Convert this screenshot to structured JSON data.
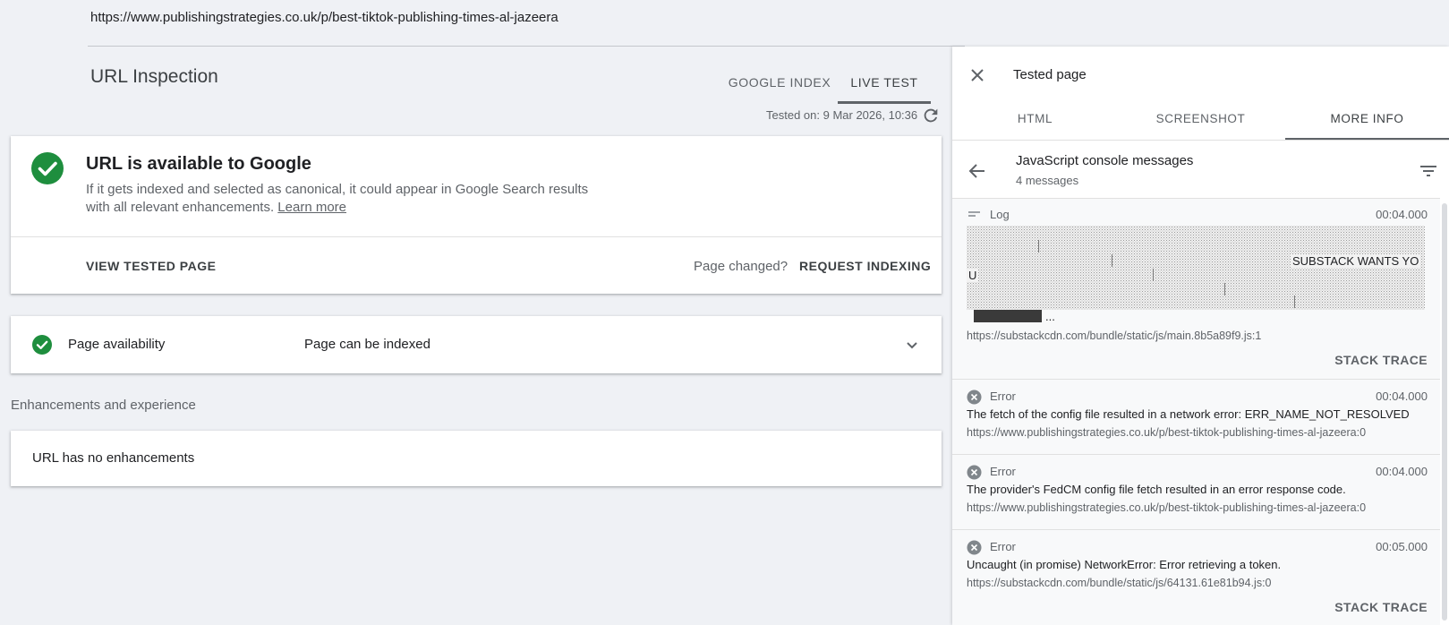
{
  "url_bar": {
    "url": "https://www.publishingstrategies.co.uk/p/best-tiktok-publishing-times-al-jazeera"
  },
  "header": {
    "title": "URL Inspection",
    "tabs": [
      {
        "label": "GOOGLE INDEX"
      },
      {
        "label": "LIVE TEST"
      }
    ],
    "tested_on": "Tested on: 9 Mar 2026, 10:36"
  },
  "status": {
    "title": "URL is available to Google",
    "description": "If it gets indexed and selected as canonical, it could appear in Google Search results with all relevant enhancements.",
    "learn_more": "Learn more",
    "view_tested_page": "VIEW TESTED PAGE",
    "page_changed": "Page changed?",
    "request_indexing": "REQUEST INDEXING"
  },
  "availability": {
    "label": "Page availability",
    "value": "Page can be indexed"
  },
  "enhancements": {
    "section_label": "Enhancements and experience",
    "text": "URL has no enhancements"
  },
  "panel": {
    "title": "Tested page",
    "tabs": [
      {
        "label": "HTML"
      },
      {
        "label": "SCREENSHOT"
      },
      {
        "label": "MORE INFO"
      }
    ],
    "console_title": "JavaScript console messages",
    "console_count": "4 messages",
    "messages": [
      {
        "type": "Log",
        "time": "00:04.000",
        "text_fragments": [
          "SUBSTACK WANTS YO",
          "U",
          "..."
        ],
        "source": "https://substackcdn.com/bundle/static/js/main.8b5a89f9.js:1",
        "action": "STACK TRACE"
      },
      {
        "type": "Error",
        "time": "00:04.000",
        "text": "The fetch of the config file resulted in a network error: ERR_NAME_NOT_RESOLVED",
        "source": "https://www.publishingstrategies.co.uk/p/best-tiktok-publishing-times-al-jazeera:0"
      },
      {
        "type": "Error",
        "time": "00:04.000",
        "text": "The provider's FedCM config file fetch resulted in an error response code.",
        "source": "https://www.publishingstrategies.co.uk/p/best-tiktok-publishing-times-al-jazeera:0"
      },
      {
        "type": "Error",
        "time": "00:05.000",
        "text": "Uncaught (in promise) NetworkError: Error retrieving a token.",
        "source": "https://substackcdn.com/bundle/static/js/64131.61e81b94.js:0",
        "action": "STACK TRACE"
      }
    ]
  },
  "colors": {
    "success": "#1e8e3e",
    "accent": "#5f6368",
    "background": "#eff1f5"
  },
  "icons": {
    "status": "check-circle-icon",
    "refresh": "refresh-icon",
    "expand": "chevron-down-icon",
    "close": "close-icon",
    "back": "arrow-back-icon",
    "filter": "filter-icon",
    "log": "log-lines-icon",
    "error": "error-circle-icon"
  }
}
